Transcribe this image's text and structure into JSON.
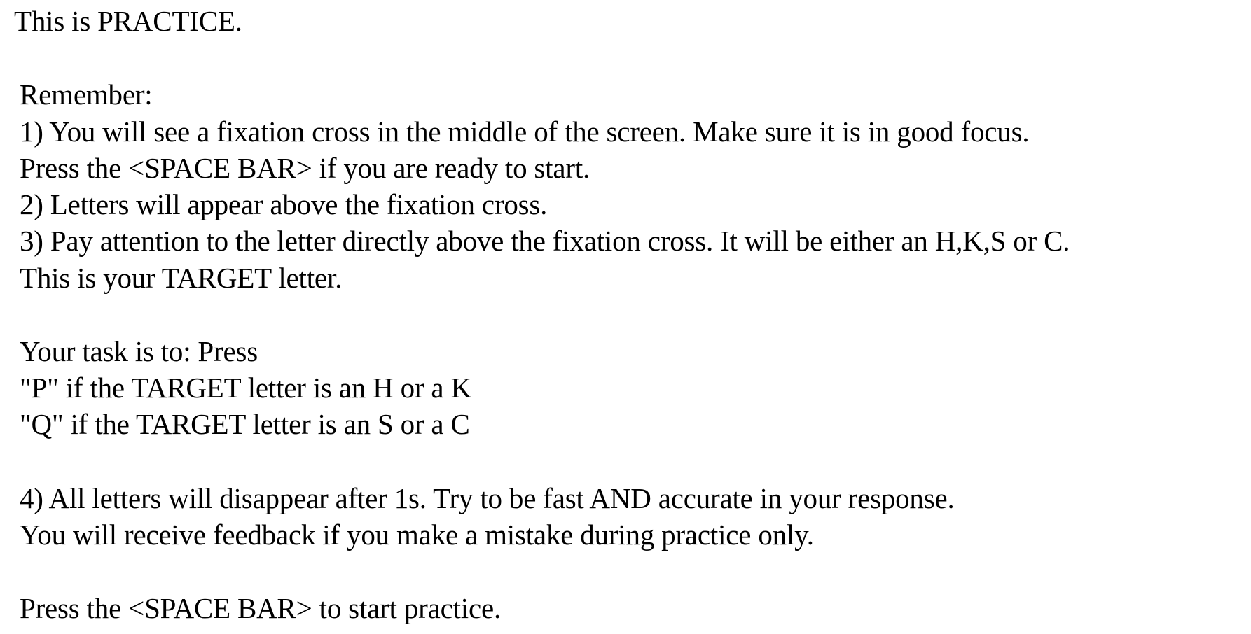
{
  "heading": "This is PRACTICE.",
  "remember_label": "Remember:",
  "instruction_lines": [
    "1) You will see a fixation cross in the middle of the screen. Make sure it is in good focus.",
    "Press the <SPACE BAR> if you are ready to start.",
    "2) Letters will appear above the fixation cross.",
    "3) Pay attention to the letter directly above the fixation cross. It will be either an H,K,S or C.",
    "This is your TARGET letter."
  ],
  "task_lines": [
    "Your task is to: Press",
    "\"P\" if the TARGET letter is an H or a K",
    "\"Q\" if the TARGET letter is an S or a C"
  ],
  "final_lines": [
    "4) All letters will disappear after 1s. Try to be fast AND accurate in your response.",
    "You will receive feedback if you make a mistake during practice only."
  ],
  "start_prompt": "Press the <SPACE BAR> to start practice."
}
